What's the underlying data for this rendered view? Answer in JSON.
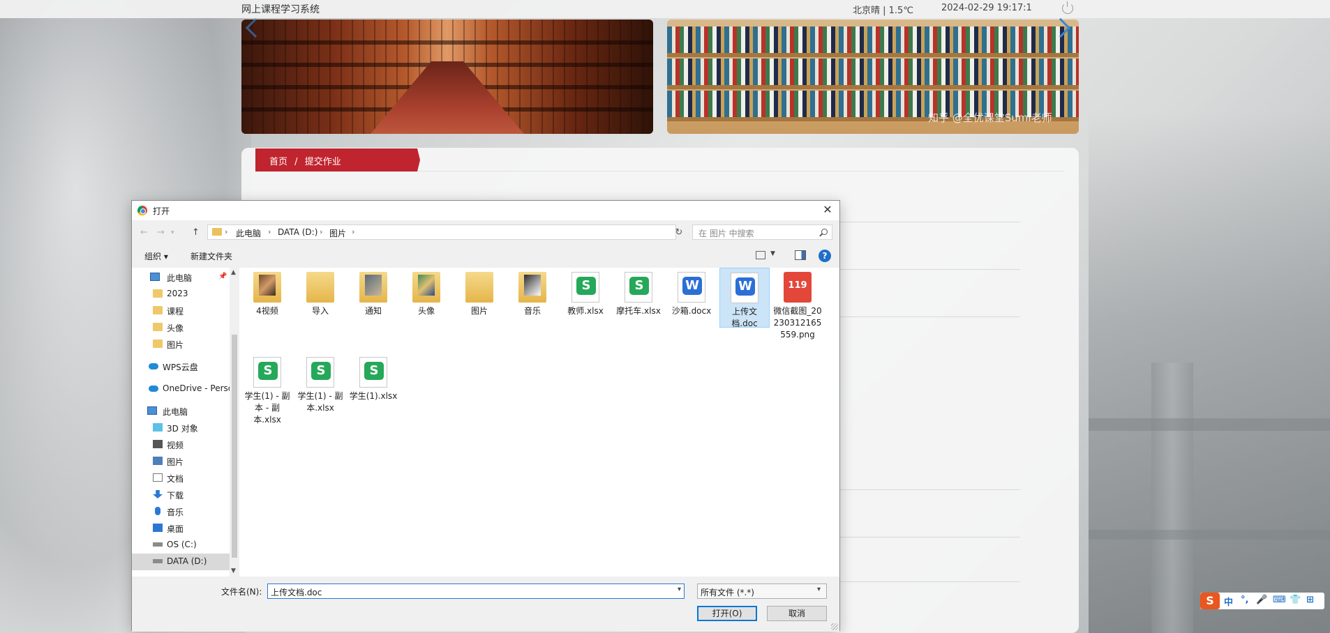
{
  "site": {
    "title": "网上课程学习系统",
    "weather": "北京晴 | 1.5℃",
    "datetime": "2024-02-29   19:17:1",
    "watermark": "知乎 @全优课堂Sumi老师"
  },
  "breadcrumb": {
    "home": "首页",
    "sep": "/",
    "current": "提交作业"
  },
  "dialog": {
    "title": "打开",
    "address": [
      "此电脑",
      "DATA (D:)",
      "图片"
    ],
    "search_placeholder": "在 图片 中搜索",
    "toolbar": {
      "organize": "组织 ▾",
      "new_folder": "新建文件夹"
    },
    "sidebar": [
      {
        "label": "此电脑",
        "icon": "computer-icon"
      },
      {
        "label": "2023",
        "icon": "folder-icon"
      },
      {
        "label": "课程",
        "icon": "folder-icon"
      },
      {
        "label": "头像",
        "icon": "folder-icon"
      },
      {
        "label": "图片",
        "icon": "folder-icon"
      },
      {
        "label": "WPS云盘",
        "icon": "cloud-icon"
      },
      {
        "label": "OneDrive - Perso",
        "icon": "cloud-icon"
      },
      {
        "label": "此电脑",
        "icon": "computer-icon"
      },
      {
        "label": "3D 对象",
        "icon": "cube-icon"
      },
      {
        "label": "视频",
        "icon": "video-icon"
      },
      {
        "label": "图片",
        "icon": "pictures-icon"
      },
      {
        "label": "文档",
        "icon": "document-icon"
      },
      {
        "label": "下载",
        "icon": "download-icon"
      },
      {
        "label": "音乐",
        "icon": "music-icon"
      },
      {
        "label": "桌面",
        "icon": "desktop-icon"
      },
      {
        "label": "OS (C:)",
        "icon": "drive-icon"
      },
      {
        "label": "DATA (D:)",
        "icon": "drive-icon"
      }
    ],
    "files": [
      {
        "name": "4视频",
        "type": "folder"
      },
      {
        "name": "导入",
        "type": "folder"
      },
      {
        "name": "通知",
        "type": "folder"
      },
      {
        "name": "头像",
        "type": "folder"
      },
      {
        "name": "图片",
        "type": "folder"
      },
      {
        "name": "音乐",
        "type": "folder"
      },
      {
        "name": "教师.xlsx",
        "type": "sheet"
      },
      {
        "name": "摩托车.xlsx",
        "type": "sheet"
      },
      {
        "name": "沙箱.docx",
        "type": "word"
      },
      {
        "name": "上传文档.doc",
        "type": "word",
        "selected": true
      },
      {
        "name": "微信截图_20230312165559.png",
        "type": "image"
      },
      {
        "name": "学生(1) - 副本 - 副本.xlsx",
        "type": "sheet"
      },
      {
        "name": "学生(1) - 副本.xlsx",
        "type": "sheet"
      },
      {
        "name": "学生(1).xlsx",
        "type": "sheet"
      }
    ],
    "filename_label": "文件名(N):",
    "filename_value": "上传文档.doc",
    "filetype": "所有文件 (*.*)",
    "open_button": "打开(O)",
    "cancel_button": "取消"
  },
  "ime": {
    "logo": "S",
    "lang": "中",
    "punct": "°,",
    "mic": "🎤",
    "keyboard": "⌨",
    "shirt": "👕",
    "grid": "⊞"
  }
}
